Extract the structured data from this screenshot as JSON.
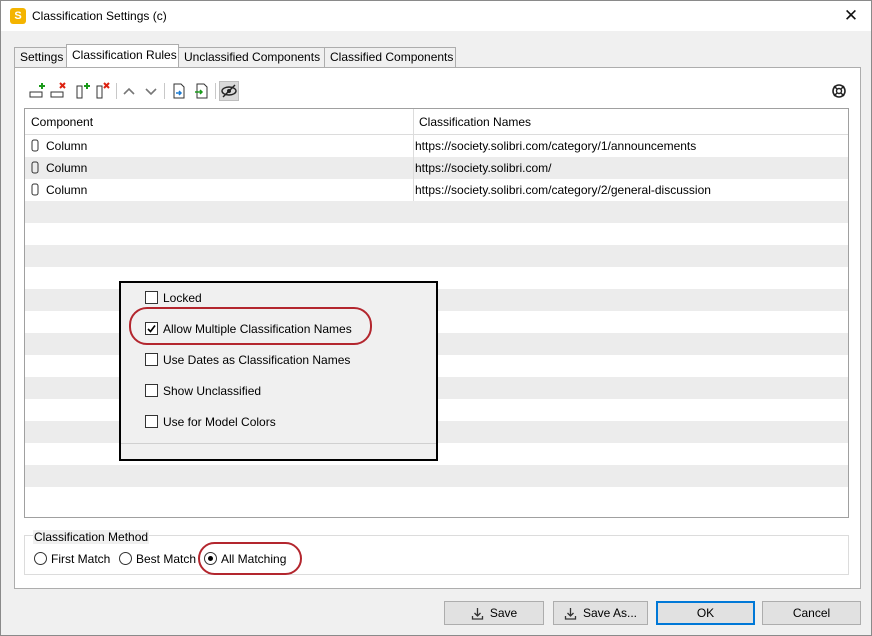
{
  "window": {
    "title": "Classification Settings (c)",
    "app_icon_letter": "S"
  },
  "tabs": [
    {
      "label": "Settings",
      "active": false
    },
    {
      "label": "Classification Rules",
      "active": true
    },
    {
      "label": "Unclassified Components",
      "active": false
    },
    {
      "label": "Classified Components",
      "active": false
    }
  ],
  "toolbar": {
    "icons": [
      "add-row-icon",
      "remove-row-icon",
      "add-column-icon",
      "remove-column-icon",
      "move-up-icon",
      "move-down-icon",
      "import-icon",
      "export-icon",
      "visibility-icon",
      "help-icon"
    ]
  },
  "table": {
    "headers": [
      "Component",
      "Classification Names"
    ],
    "rows": [
      {
        "component": "Column",
        "classification": "https://society.solibri.com/category/1/announcements"
      },
      {
        "component": "Column",
        "classification": "https://society.solibri.com/"
      },
      {
        "component": "Column",
        "classification": "https://society.solibri.com/category/2/general-discussion"
      }
    ]
  },
  "options": [
    {
      "label": "Locked",
      "checked": false
    },
    {
      "label": "Allow Multiple Classification Names",
      "checked": true
    },
    {
      "label": "Use Dates as Classification Names",
      "checked": false
    },
    {
      "label": "Show Unclassified",
      "checked": false
    },
    {
      "label": "Use for Model Colors",
      "checked": false
    }
  ],
  "method": {
    "title": "Classification Method",
    "options": [
      {
        "label": "First Match",
        "selected": false
      },
      {
        "label": "Best Match",
        "selected": false
      },
      {
        "label": "All Matching",
        "selected": true
      }
    ]
  },
  "buttons": {
    "save": "Save",
    "save_as": "Save As...",
    "ok": "OK",
    "cancel": "Cancel"
  },
  "colors": {
    "highlight": "#b3262e",
    "stripe": "#ececec",
    "accent": "#0078d7"
  }
}
